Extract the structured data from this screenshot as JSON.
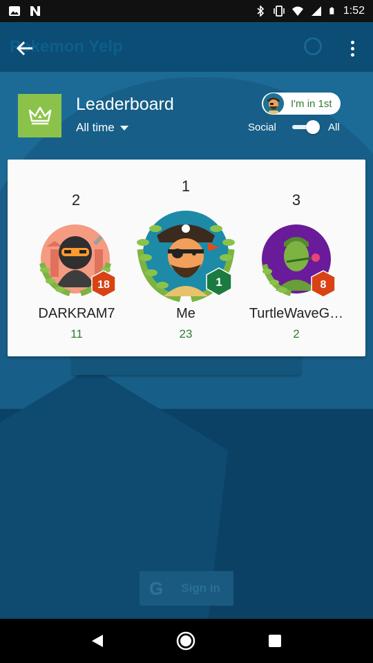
{
  "status_bar": {
    "time": "1:52"
  },
  "background": {
    "app_title": "Pokemon Yelp",
    "sign_in_label": "Sign in",
    "google_glyph": "G"
  },
  "header": {
    "title": "Leaderboard",
    "time_filter": "All time",
    "position_chip": "I'm in 1st",
    "toggle_left": "Social",
    "toggle_right": "All",
    "toggle_state": "All"
  },
  "podium": [
    {
      "rank": "2",
      "name": "DARKRAM7",
      "score": "11",
      "level": "18",
      "avatar": "ninja-avatar",
      "badge_color": "#d84315"
    },
    {
      "rank": "1",
      "name": "Me",
      "score": "23",
      "level": "1",
      "avatar": "pirate-avatar",
      "badge_color": "#1b7a3f"
    },
    {
      "rank": "3",
      "name": "TurtleWaveG…",
      "score": "2",
      "level": "8",
      "avatar": "soldier-avatar",
      "badge_color": "#d84315"
    }
  ],
  "colors": {
    "accent_green": "#8bc34a",
    "score_green": "#2e7d32",
    "badge_orange": "#d84315",
    "badge_green": "#1b7a3f",
    "background_blue": "#1c6b97"
  }
}
